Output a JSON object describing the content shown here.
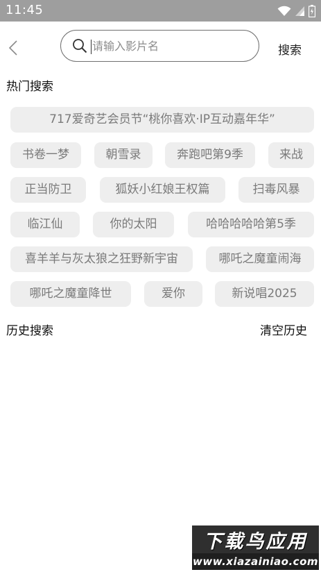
{
  "status_bar": {
    "time": "11:45",
    "icons": [
      "wifi-icon",
      "cell-signal-icon",
      "battery-icon"
    ]
  },
  "header": {
    "back_icon": "chevron-left-icon",
    "search_icon": "search-icon",
    "search_placeholder": "请输入影片名",
    "search_value": "",
    "search_button_label": "搜索"
  },
  "hot_search": {
    "title": "热门搜索",
    "tags": [
      "717爱奇艺会员节“桃你喜欢·IP互动嘉年华”",
      "书卷一梦",
      "朝雪录",
      "奔跑吧第9季",
      "来战",
      "正当防卫",
      "狐妖小红娘王权篇",
      "扫毒风暴",
      "临江仙",
      "你的太阳",
      "哈哈哈哈哈第5季",
      "喜羊羊与灰太狼之狂野新宇宙",
      "哪吒之魔童闹海",
      "哪吒之魔童降世",
      "爱你",
      "新说唱2025"
    ]
  },
  "history": {
    "title": "历史搜索",
    "clear_label": "清空历史",
    "items": []
  },
  "watermark": {
    "line1": "下载鸟应用",
    "line2": "www.xiazainiao.com"
  },
  "colors": {
    "status_bar": "#9e9e9e",
    "tag_background": "#eeeeee",
    "tag_text": "#7a7a7a"
  }
}
